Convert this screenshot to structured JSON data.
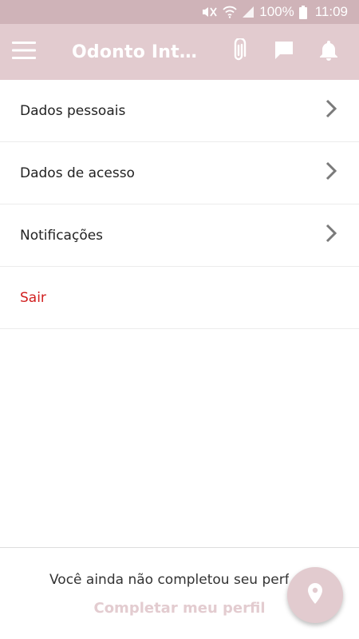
{
  "status_bar": {
    "battery_percent": "100%",
    "time": "11:09",
    "icons": [
      "mute-icon",
      "wifi-icon",
      "signal-icon",
      "battery-icon"
    ]
  },
  "app_bar": {
    "title": "Odonto Integr...",
    "icons": [
      "menu-icon",
      "paperclip-icon",
      "chat-icon",
      "bell-icon"
    ]
  },
  "menu": {
    "items": [
      {
        "label": "Dados pessoais",
        "has_chevron": true
      },
      {
        "label": "Dados de acesso",
        "has_chevron": true
      },
      {
        "label": "Notificações",
        "has_chevron": true
      },
      {
        "label": "Sair",
        "has_chevron": false
      }
    ]
  },
  "footer": {
    "message": "Você ainda não completou seu perfil",
    "link_label": "Completar meu perfil"
  },
  "fab": {
    "icon": "location-pin-icon"
  },
  "colors": {
    "status_bar_bg": "#cfb3b8",
    "app_bar_bg": "#e2cbcf",
    "logout_text": "#d11f1f",
    "link_text": "#e3ccd0"
  }
}
